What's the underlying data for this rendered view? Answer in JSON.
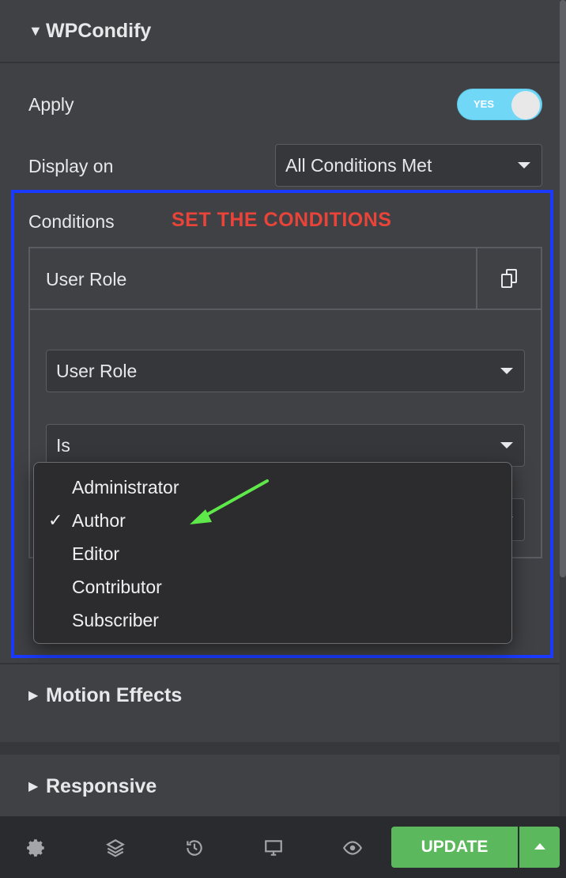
{
  "sections": {
    "wpcondify": {
      "title": "WPCondify"
    },
    "motion": {
      "title": "Motion Effects"
    },
    "responsive": {
      "title": "Responsive"
    }
  },
  "apply": {
    "label": "Apply",
    "toggle_text": "YES",
    "value": true
  },
  "display_on": {
    "label": "Display on",
    "value": "All Conditions Met"
  },
  "conditions": {
    "label": "Conditions",
    "annotation": "SET THE CONDITIONS",
    "item_title": "User Role",
    "field_type": "User Role",
    "operator": "Is"
  },
  "dropdown": {
    "options": [
      "Administrator",
      "Author",
      "Editor",
      "Contributor",
      "Subscriber"
    ],
    "selected": "Author"
  },
  "footer": {
    "update_label": "UPDATE"
  },
  "colors": {
    "accent": "#5cb85c",
    "toggle": "#71d7f7",
    "highlight": "#1a3bff",
    "annotation": "#e8443a",
    "arrow": "#5ee84a"
  }
}
